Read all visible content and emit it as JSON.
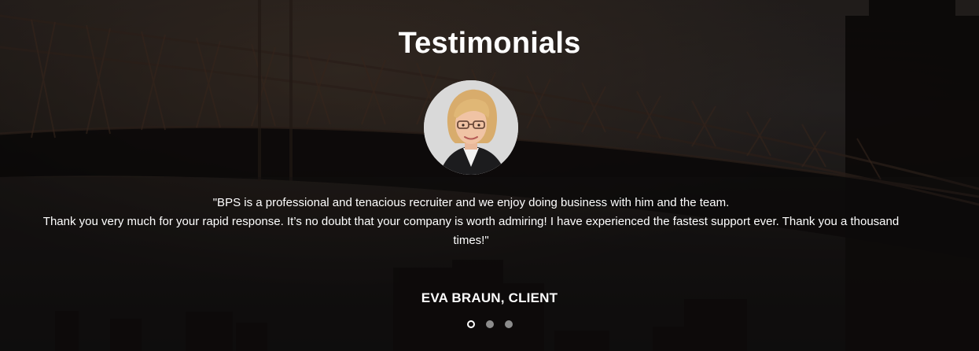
{
  "section": {
    "title": "Testimonials"
  },
  "testimonial": {
    "quote_line1": "\"BPS is a professional and tenacious recruiter and we enjoy doing business with him and the team.",
    "quote_line2": "Thank you very much for your rapid response. It’s no doubt that your company is worth admiring! I have experienced the fastest support ever. Thank you a thousand times!\"",
    "author": "EVA BRAUN, CLIENT"
  },
  "carousel": {
    "slide_count": 3,
    "active_index": 0
  },
  "colors": {
    "text": "#ffffff",
    "dot_inactive": "#8c8c8c",
    "dot_active_border": "#ffffff"
  }
}
